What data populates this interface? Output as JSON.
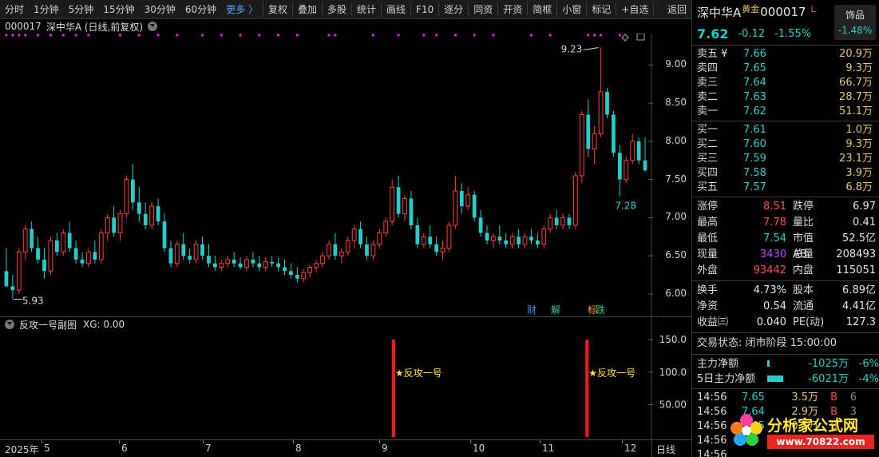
{
  "toolbar": {
    "items": [
      {
        "label": "分时"
      },
      {
        "label": "1分钟"
      },
      {
        "label": "5分钟"
      },
      {
        "label": "15分钟"
      },
      {
        "label": "30分钟"
      },
      {
        "label": "60分钟"
      },
      {
        "label": "更多 〉"
      },
      {
        "label": "复权"
      },
      {
        "label": "叠加"
      },
      {
        "label": "多股"
      },
      {
        "label": "统计"
      },
      {
        "label": "画线"
      },
      {
        "label": "F10"
      },
      {
        "label": "逐分"
      },
      {
        "label": "同资"
      },
      {
        "label": "开资"
      },
      {
        "label": "简框"
      },
      {
        "label": "小窗"
      },
      {
        "label": "标记"
      },
      {
        "label": "+自选"
      },
      {
        "label": "返回"
      }
    ]
  },
  "chart": {
    "code": "000017",
    "title": "深中华A (日线,前复权)",
    "high_label": "9.23",
    "low_label": "5.93",
    "recent_low_label": "7.28",
    "price_ticks": [
      "9.00",
      "8.50",
      "8.00",
      "7.50",
      "7.00",
      "6.50",
      "6.00"
    ],
    "icons": {
      "cai": "财",
      "jie": "解",
      "biao": "标",
      "die": "跌"
    },
    "colors": {
      "up": "#ff3b3b",
      "down": "#20d0c8",
      "signal": "#ff1a1a",
      "marker": "#e020e0"
    }
  },
  "subchart": {
    "title": "反攻一号副图",
    "xg": "XG: 0.00",
    "ticks": [
      "150.0",
      "100.0",
      "50.00"
    ],
    "signal_label": "★反攻一号"
  },
  "xaxis": {
    "labels": [
      "2025年",
      "5",
      "6",
      "7",
      "8",
      "9",
      "10",
      "11",
      "12"
    ],
    "period": "日线"
  },
  "panel": {
    "name": "深中华A",
    "gold": "黄金",
    "code": "000017",
    "flag": "L",
    "sector": {
      "name": "饰品",
      "pct": "-1.48%"
    },
    "last": "7.62",
    "change": "-0.12",
    "change_pct": "-1.55%",
    "sell": [
      {
        "label": "卖五 ¥",
        "price": "7.66",
        "vol": "20.9万"
      },
      {
        "label": "卖四",
        "price": "7.65",
        "vol": "9.3万"
      },
      {
        "label": "卖三",
        "price": "7.64",
        "vol": "66.7万"
      },
      {
        "label": "卖二",
        "price": "7.63",
        "vol": "28.7万"
      },
      {
        "label": "卖一",
        "price": "7.62",
        "vol": "51.1万"
      }
    ],
    "buy": [
      {
        "label": "买一",
        "price": "7.61",
        "vol": "1.0万"
      },
      {
        "label": "买二",
        "price": "7.60",
        "vol": "9.3万"
      },
      {
        "label": "买三",
        "price": "7.59",
        "vol": "23.1万"
      },
      {
        "label": "买四",
        "price": "7.58",
        "vol": "3.9万"
      },
      {
        "label": "买五",
        "price": "7.57",
        "vol": "6.8万"
      }
    ],
    "stats1": [
      {
        "k": "涨停",
        "v": "8.51",
        "vc": "red",
        "k2": "跌停",
        "v2": "6.97",
        "v2c": "green"
      },
      {
        "k": "最高",
        "v": "7.78",
        "vc": "red",
        "k2": "量比",
        "v2": "0.41",
        "v2c": "white"
      },
      {
        "k": "最低",
        "v": "7.54",
        "vc": "green",
        "k2": "市值AB",
        "v2": "52.5亿",
        "v2c": "white"
      },
      {
        "k": "现量",
        "v": "3430",
        "vc": "purple",
        "k2": "总量",
        "v2": "208493",
        "v2c": "white"
      },
      {
        "k": "外盘",
        "v": "93442",
        "vc": "red",
        "k2": "内盘",
        "v2": "115051",
        "v2c": "green"
      }
    ],
    "stats2": [
      {
        "k": "换手",
        "v": "4.73%",
        "vc": "white",
        "k2": "股本",
        "v2": "6.89亿",
        "v2c": "white"
      },
      {
        "k": "净资",
        "v": "0.54",
        "vc": "white",
        "k2": "流通",
        "v2": "4.41亿",
        "v2c": "white"
      },
      {
        "k": "收益㈢",
        "v": "0.040",
        "vc": "white",
        "k2": "PE(动)",
        "v2": "127.3",
        "v2c": "white"
      }
    ],
    "trade_state": "交易状态: 闭市阶段 15:00:00",
    "flows": [
      {
        "k": "主力净额",
        "val": "-1025万",
        "pct": "-6%",
        "bar": 0.08
      },
      {
        "k": "5日主力净额",
        "val": "-6021万",
        "pct": "-4%",
        "bar": 0.55
      }
    ],
    "ticks": [
      {
        "t": "14:56",
        "p": "7.65",
        "v": "3.5万",
        "bs": "B",
        "n": "6"
      },
      {
        "t": "14:56",
        "p": "7.64",
        "v": "2.9万",
        "bs": "B",
        "n": "3"
      },
      {
        "t": "14:56",
        "p": "7.65",
        "v": "0.5万",
        "bs": "B",
        "n": "1"
      },
      {
        "t": "14:56",
        "p": "",
        "v": "",
        "bs": "",
        "n": ""
      },
      {
        "t": "14:56",
        "p": "",
        "v": "",
        "bs": "",
        "n": ""
      },
      {
        "t": "15:",
        "p": "",
        "v": "",
        "bs": "",
        "n": ""
      }
    ]
  },
  "watermark": {
    "title": "分析家公式网",
    "url": "www.70822.com"
  },
  "chart_data": {
    "type": "candlestick",
    "ylim": [
      5.8,
      9.35
    ],
    "x_months": [
      "2025年",
      "5",
      "6",
      "7",
      "8",
      "9",
      "10",
      "11",
      "12"
    ],
    "ohlc": [
      [
        6.3,
        6.6,
        6.1,
        6.1
      ],
      [
        6.1,
        6.25,
        5.93,
        6.05
      ],
      [
        6.05,
        6.6,
        6.0,
        6.55
      ],
      [
        6.55,
        6.9,
        6.45,
        6.85
      ],
      [
        6.85,
        6.95,
        6.55,
        6.6
      ],
      [
        6.6,
        6.75,
        6.4,
        6.45
      ],
      [
        6.45,
        6.6,
        6.2,
        6.3
      ],
      [
        6.3,
        6.75,
        6.25,
        6.7
      ],
      [
        6.7,
        6.8,
        6.5,
        6.55
      ],
      [
        6.55,
        6.85,
        6.5,
        6.8
      ],
      [
        6.8,
        6.95,
        6.55,
        6.6
      ],
      [
        6.6,
        6.7,
        6.4,
        6.45
      ],
      [
        6.45,
        6.55,
        6.35,
        6.4
      ],
      [
        6.4,
        6.6,
        6.35,
        6.55
      ],
      [
        6.55,
        6.7,
        6.4,
        6.45
      ],
      [
        6.45,
        6.85,
        6.4,
        6.8
      ],
      [
        6.8,
        7.05,
        6.7,
        7.0
      ],
      [
        7.0,
        7.15,
        6.75,
        6.8
      ],
      [
        6.8,
        7.1,
        6.7,
        7.05
      ],
      [
        7.05,
        7.55,
        7.0,
        7.5
      ],
      [
        7.5,
        7.7,
        7.1,
        7.2
      ],
      [
        7.2,
        7.4,
        6.95,
        7.05
      ],
      [
        7.05,
        7.2,
        6.85,
        6.9
      ],
      [
        6.9,
        7.2,
        6.85,
        7.15
      ],
      [
        7.15,
        7.25,
        6.9,
        6.95
      ],
      [
        6.95,
        7.05,
        6.55,
        6.6
      ],
      [
        6.6,
        6.7,
        6.35,
        6.4
      ],
      [
        6.4,
        6.7,
        6.35,
        6.65
      ],
      [
        6.65,
        6.8,
        6.45,
        6.5
      ],
      [
        6.5,
        6.6,
        6.4,
        6.45
      ],
      [
        6.45,
        6.7,
        6.4,
        6.65
      ],
      [
        6.65,
        6.75,
        6.45,
        6.5
      ],
      [
        6.5,
        6.65,
        6.35,
        6.4
      ],
      [
        6.4,
        6.5,
        6.3,
        6.35
      ],
      [
        6.35,
        6.45,
        6.3,
        6.4
      ],
      [
        6.4,
        6.5,
        6.35,
        6.45
      ],
      [
        6.45,
        6.55,
        6.35,
        6.4
      ],
      [
        6.4,
        6.48,
        6.32,
        6.35
      ],
      [
        6.35,
        6.5,
        6.3,
        6.45
      ],
      [
        6.45,
        6.55,
        6.35,
        6.4
      ],
      [
        6.4,
        6.5,
        6.3,
        6.35
      ],
      [
        6.35,
        6.48,
        6.3,
        6.42
      ],
      [
        6.42,
        6.5,
        6.35,
        6.4
      ],
      [
        6.4,
        6.48,
        6.3,
        6.35
      ],
      [
        6.35,
        6.45,
        6.25,
        6.3
      ],
      [
        6.3,
        6.4,
        6.2,
        6.25
      ],
      [
        6.25,
        6.35,
        6.15,
        6.2
      ],
      [
        6.2,
        6.32,
        6.15,
        6.28
      ],
      [
        6.28,
        6.38,
        6.22,
        6.35
      ],
      [
        6.35,
        6.45,
        6.28,
        6.4
      ],
      [
        6.4,
        6.55,
        6.35,
        6.5
      ],
      [
        6.5,
        6.7,
        6.45,
        6.65
      ],
      [
        6.65,
        6.8,
        6.45,
        6.5
      ],
      [
        6.5,
        6.6,
        6.4,
        6.55
      ],
      [
        6.55,
        6.75,
        6.5,
        6.7
      ],
      [
        6.7,
        6.9,
        6.6,
        6.85
      ],
      [
        6.85,
        6.95,
        6.6,
        6.65
      ],
      [
        6.65,
        6.75,
        6.45,
        6.5
      ],
      [
        6.5,
        6.7,
        6.45,
        6.65
      ],
      [
        6.65,
        6.85,
        6.6,
        6.8
      ],
      [
        6.8,
        7.0,
        6.75,
        6.95
      ],
      [
        6.95,
        7.5,
        6.9,
        7.4
      ],
      [
        7.4,
        7.55,
        7.0,
        7.05
      ],
      [
        7.05,
        7.3,
        6.95,
        7.25
      ],
      [
        7.25,
        7.35,
        6.85,
        6.9
      ],
      [
        6.9,
        7.0,
        6.6,
        6.65
      ],
      [
        6.65,
        6.8,
        6.6,
        6.75
      ],
      [
        6.75,
        6.9,
        6.6,
        6.65
      ],
      [
        6.65,
        6.75,
        6.5,
        6.55
      ],
      [
        6.55,
        6.7,
        6.45,
        6.6
      ],
      [
        6.6,
        6.95,
        6.55,
        6.9
      ],
      [
        6.9,
        7.55,
        6.85,
        7.35
      ],
      [
        7.35,
        7.45,
        7.05,
        7.15
      ],
      [
        7.15,
        7.4,
        7.1,
        7.3
      ],
      [
        7.3,
        7.35,
        6.95,
        7.0
      ],
      [
        7.0,
        7.1,
        6.75,
        6.8
      ],
      [
        6.8,
        6.9,
        6.65,
        6.7
      ],
      [
        6.7,
        6.8,
        6.6,
        6.75
      ],
      [
        6.75,
        6.9,
        6.65,
        6.7
      ],
      [
        6.7,
        6.8,
        6.6,
        6.65
      ],
      [
        6.65,
        6.8,
        6.6,
        6.75
      ],
      [
        6.75,
        6.85,
        6.6,
        6.65
      ],
      [
        6.65,
        6.8,
        6.6,
        6.75
      ],
      [
        6.75,
        6.85,
        6.65,
        6.7
      ],
      [
        6.7,
        6.8,
        6.6,
        6.65
      ],
      [
        6.65,
        6.9,
        6.6,
        6.85
      ],
      [
        6.85,
        7.05,
        6.8,
        7.0
      ],
      [
        7.0,
        7.1,
        6.85,
        6.9
      ],
      [
        6.9,
        7.05,
        6.85,
        7.0
      ],
      [
        7.0,
        7.05,
        6.85,
        6.9
      ],
      [
        6.9,
        7.6,
        6.85,
        7.55
      ],
      [
        7.55,
        8.4,
        7.45,
        8.35
      ],
      [
        8.35,
        8.55,
        7.8,
        7.9
      ],
      [
        7.9,
        8.2,
        7.7,
        8.1
      ],
      [
        8.1,
        9.23,
        8.05,
        8.65
      ],
      [
        8.65,
        8.7,
        8.3,
        8.35
      ],
      [
        8.35,
        8.4,
        7.8,
        7.85
      ],
      [
        7.85,
        7.95,
        7.28,
        7.5
      ],
      [
        7.5,
        7.8,
        7.45,
        7.75
      ],
      [
        7.75,
        8.1,
        7.7,
        8.0
      ],
      [
        8.0,
        8.05,
        7.7,
        7.75
      ],
      [
        7.75,
        8.05,
        7.6,
        7.62
      ]
    ],
    "signal_positions": [
      0.605,
      0.905
    ],
    "signal_value": 150
  }
}
